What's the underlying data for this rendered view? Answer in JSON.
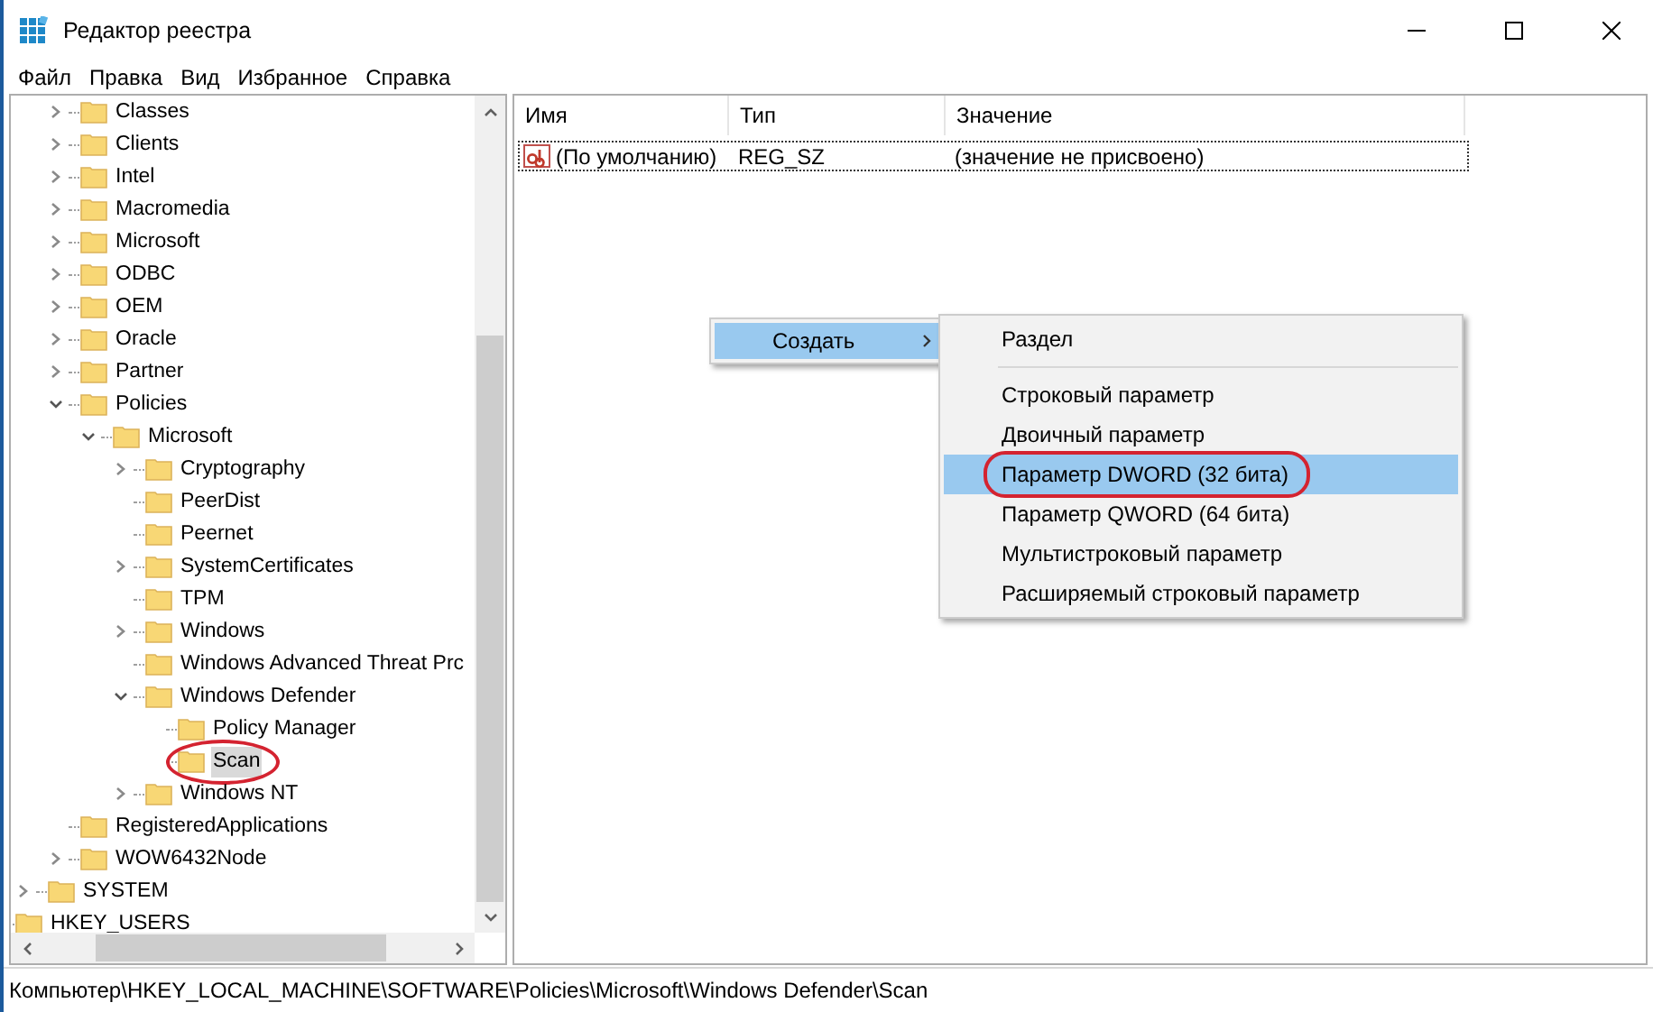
{
  "window": {
    "title": "Редактор реестра"
  },
  "menu": [
    "Файл",
    "Правка",
    "Вид",
    "Избранное",
    "Справка"
  ],
  "tree": {
    "software_keys": [
      {
        "label": "Classes",
        "kind": "branch",
        "expanded": false,
        "selected": false,
        "circled": false
      },
      {
        "label": "Clients",
        "kind": "branch",
        "expanded": false,
        "selected": false,
        "circled": false
      },
      {
        "label": "Intel",
        "kind": "branch",
        "expanded": false,
        "selected": false,
        "circled": false
      },
      {
        "label": "Macromedia",
        "kind": "branch",
        "expanded": false,
        "selected": false,
        "circled": false
      },
      {
        "label": "Microsoft",
        "kind": "branch",
        "expanded": false,
        "selected": false,
        "circled": false
      },
      {
        "label": "ODBC",
        "kind": "branch",
        "expanded": false,
        "selected": false,
        "circled": false
      },
      {
        "label": "OEM",
        "kind": "branch",
        "expanded": false,
        "selected": false,
        "circled": false
      },
      {
        "label": "Oracle",
        "kind": "branch",
        "expanded": false,
        "selected": false,
        "circled": false
      },
      {
        "label": "Partner",
        "kind": "branch",
        "expanded": false,
        "selected": false,
        "circled": false
      },
      {
        "label": "Policies",
        "kind": "branch",
        "expanded": true,
        "selected": false,
        "circled": false,
        "children": [
          {
            "label": "Microsoft",
            "kind": "branch",
            "expanded": true,
            "selected": false,
            "circled": false,
            "children": [
              {
                "label": "Cryptography",
                "kind": "branch",
                "expanded": false,
                "selected": false,
                "circled": false
              },
              {
                "label": "PeerDist",
                "kind": "leaf",
                "selected": false,
                "circled": false
              },
              {
                "label": "Peernet",
                "kind": "leaf",
                "selected": false,
                "circled": false
              },
              {
                "label": "SystemCertificates",
                "kind": "branch",
                "expanded": false,
                "selected": false,
                "circled": false
              },
              {
                "label": "TPM",
                "kind": "leaf",
                "selected": false,
                "circled": false
              },
              {
                "label": "Windows",
                "kind": "branch",
                "expanded": false,
                "selected": false,
                "circled": false
              },
              {
                "label": "Windows Advanced Threat Prc",
                "kind": "leaf",
                "selected": false,
                "circled": false
              },
              {
                "label": "Windows Defender",
                "kind": "branch",
                "expanded": true,
                "selected": false,
                "circled": false,
                "children": [
                  {
                    "label": "Policy Manager",
                    "kind": "leaf",
                    "selected": false,
                    "circled": false
                  },
                  {
                    "label": "Scan",
                    "kind": "leaf",
                    "selected": true,
                    "circled": true
                  }
                ]
              },
              {
                "label": "Windows NT",
                "kind": "branch",
                "expanded": false,
                "selected": false,
                "circled": false
              }
            ]
          }
        ]
      },
      {
        "label": "RegisteredApplications",
        "kind": "leaf",
        "selected": false,
        "circled": false
      },
      {
        "label": "WOW6432Node",
        "kind": "branch",
        "expanded": false,
        "selected": false,
        "circled": false
      }
    ],
    "hklm_keys": [
      {
        "label": "SYSTEM",
        "kind": "branch",
        "expanded": false,
        "selected": false,
        "circled": false
      }
    ],
    "root_keys": [
      {
        "label": "HKEY_USERS",
        "kind": "leaf",
        "selected": false,
        "circled": false
      }
    ]
  },
  "list": {
    "columns": [
      "Имя",
      "Тип",
      "Значение"
    ],
    "rows": [
      {
        "name": "(По умолчанию)",
        "type": "REG_SZ",
        "value": "(значение не присвоено)",
        "focused": true
      }
    ]
  },
  "context_menu": {
    "items": [
      {
        "label": "Создать",
        "selected": true
      }
    ],
    "submenu": [
      {
        "kind": "item",
        "label": "Раздел",
        "selected": false,
        "circled": false
      },
      {
        "kind": "separator"
      },
      {
        "kind": "item",
        "label": "Строковый параметр",
        "selected": false,
        "circled": false
      },
      {
        "kind": "item",
        "label": "Двоичный параметр",
        "selected": false,
        "circled": false
      },
      {
        "kind": "item",
        "label": "Параметр DWORD (32 бита)",
        "selected": true,
        "circled": true
      },
      {
        "kind": "item",
        "label": "Параметр QWORD (64 бита)",
        "selected": false,
        "circled": false
      },
      {
        "kind": "item",
        "label": "Мультистроковый параметр",
        "selected": false,
        "circled": false
      },
      {
        "kind": "item",
        "label": "Расширяемый строковый параметр",
        "selected": false,
        "circled": false
      }
    ]
  },
  "status_bar": "Компьютер\\HKEY_LOCAL_MACHINE\\SOFTWARE\\Policies\\Microsoft\\Windows Defender\\Scan"
}
